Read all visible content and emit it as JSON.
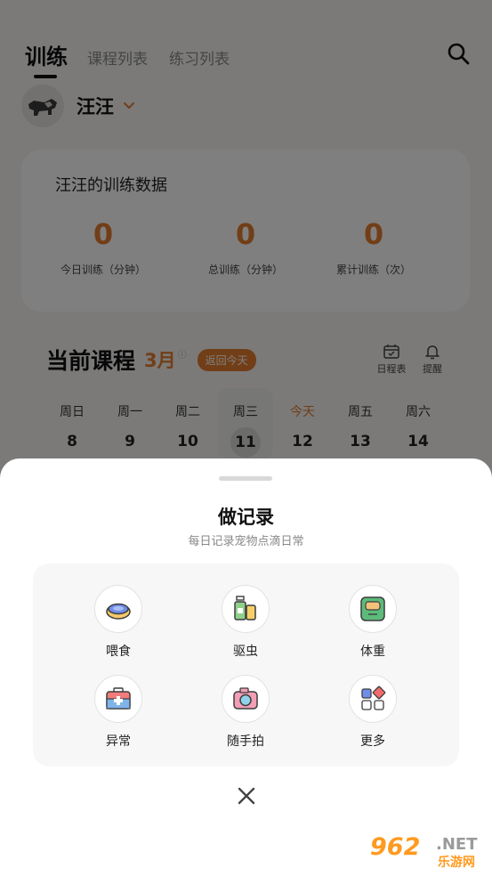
{
  "header": {
    "tabs": [
      {
        "label": "训练",
        "active": true
      },
      {
        "label": "课程列表",
        "active": false
      },
      {
        "label": "练习列表",
        "active": false
      }
    ],
    "search_icon": "search-icon"
  },
  "pet": {
    "name": "汪汪",
    "avatar_icon": "dog-avatar"
  },
  "stats": {
    "title": "汪汪的训练数据",
    "items": [
      {
        "value": "0",
        "label": "今日训练（分钟）"
      },
      {
        "value": "0",
        "label": "总训练（分钟）"
      },
      {
        "value": "0",
        "label": "累计训练（次）"
      }
    ]
  },
  "course": {
    "title": "当前课程",
    "month": "3月",
    "info_mark": "ⓘ",
    "today_button": "返回今天",
    "tools": [
      {
        "label": "日程表",
        "icon": "calendar-icon"
      },
      {
        "label": "提醒",
        "icon": "bell-icon"
      }
    ],
    "week": [
      {
        "weekday": "周日",
        "date": "8"
      },
      {
        "weekday": "周一",
        "date": "9"
      },
      {
        "weekday": "周二",
        "date": "10"
      },
      {
        "weekday": "周三",
        "date": "11",
        "selected": true
      },
      {
        "weekday": "今天",
        "date": "12",
        "today": true
      },
      {
        "weekday": "周五",
        "date": "13"
      },
      {
        "weekday": "周六",
        "date": "14"
      }
    ]
  },
  "sheet": {
    "title": "做记录",
    "subtitle": "每日记录宠物点滴日常",
    "actions": [
      {
        "label": "喂食",
        "icon": "food-bowl-icon"
      },
      {
        "label": "驱虫",
        "icon": "deworm-bottle-icon"
      },
      {
        "label": "体重",
        "icon": "scale-icon"
      },
      {
        "label": "异常",
        "icon": "medical-kit-icon"
      },
      {
        "label": "随手拍",
        "icon": "camera-icon"
      },
      {
        "label": "更多",
        "icon": "more-grid-icon"
      }
    ],
    "close_icon": "close-icon"
  },
  "watermark": {
    "number": "962",
    "domain": ".NET",
    "text": "乐游网"
  },
  "colors": {
    "accent": "#e57c2e",
    "overlay": "rgba(0,0,0,0.5)"
  }
}
